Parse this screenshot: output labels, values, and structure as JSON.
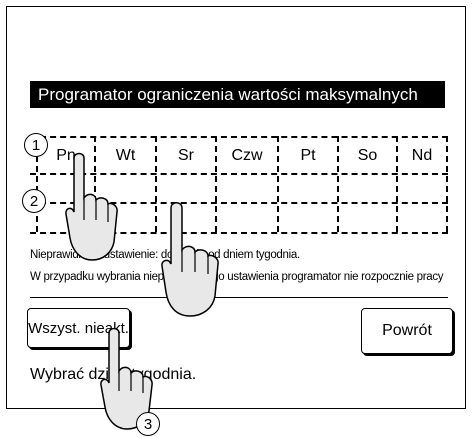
{
  "screen": {
    "title": "Programator ograniczenia wartości maksymalnych",
    "days": [
      "Pn",
      "Wt",
      "Sr",
      "Czw",
      "Pt",
      "So",
      "Nd"
    ],
    "note_line1": "Nieprawidłowe ustawienie: dotknąć pod dniem tygodnia.",
    "note_line2": "W przypadku wybrania nieprawidłowego ustawienia programator nie rozpocznie pracy",
    "btn_all_off": "Wszyst. nieakt.",
    "btn_back": "Powrót",
    "status": "Wybrać dzień tygodnia."
  },
  "callouts": {
    "one": "1",
    "two": "2",
    "three": "3"
  },
  "icons": {
    "pointer": "pointing-hand-icon"
  }
}
